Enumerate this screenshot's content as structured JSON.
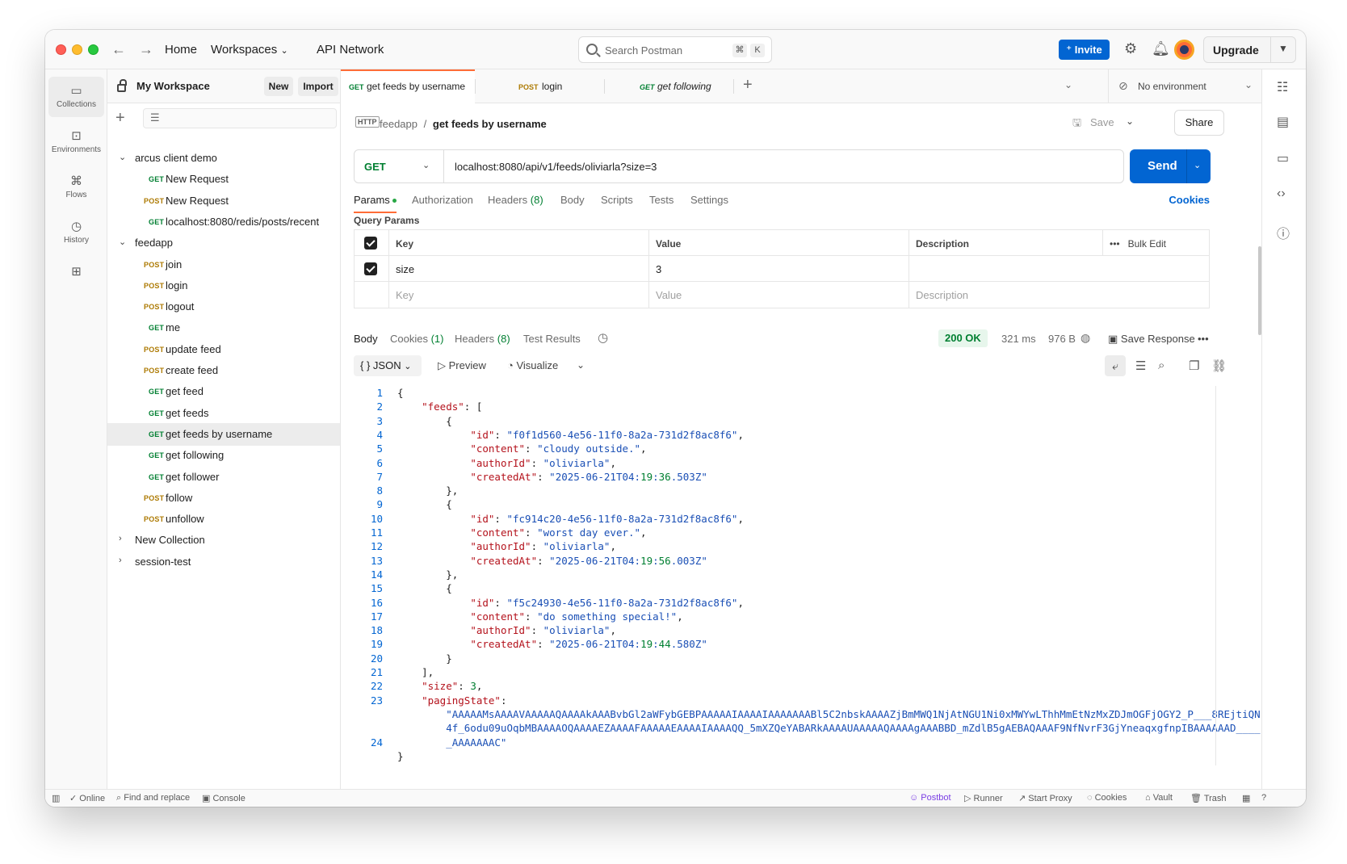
{
  "titlebar": {
    "nav": {
      "home": "Home",
      "workspaces": "Workspaces",
      "api_network": "API Network"
    },
    "search_placeholder": "Search Postman",
    "search_keys": [
      "⌘",
      "K"
    ],
    "invite": "Invite",
    "upgrade": "Upgrade"
  },
  "rail": {
    "items": [
      {
        "label": "Collections",
        "icon": "collections-icon",
        "glyph": "▭"
      },
      {
        "label": "Environments",
        "icon": "environments-icon",
        "glyph": "⊡"
      },
      {
        "label": "Flows",
        "icon": "flows-icon",
        "glyph": "⌘"
      },
      {
        "label": "History",
        "icon": "history-icon",
        "glyph": "◷"
      },
      {
        "label": "",
        "icon": "apps-icon",
        "glyph": "⊞"
      }
    ]
  },
  "sidebar": {
    "workspace_name": "My Workspace",
    "new_button": "New",
    "import_button": "Import",
    "tree": [
      {
        "type": "collection",
        "label": "arcus client demo",
        "expanded": true
      },
      {
        "type": "request",
        "method": "GET",
        "label": "New Request"
      },
      {
        "type": "request",
        "method": "POST",
        "label": "New Request"
      },
      {
        "type": "request",
        "method": "GET",
        "label": "localhost:8080/redis/posts/recent"
      },
      {
        "type": "collection",
        "label": "feedapp",
        "expanded": true
      },
      {
        "type": "request",
        "method": "POST",
        "label": "join"
      },
      {
        "type": "request",
        "method": "POST",
        "label": "login"
      },
      {
        "type": "request",
        "method": "POST",
        "label": "logout"
      },
      {
        "type": "request",
        "method": "GET",
        "label": "me"
      },
      {
        "type": "request",
        "method": "POST",
        "label": "update feed"
      },
      {
        "type": "request",
        "method": "POST",
        "label": "create feed"
      },
      {
        "type": "request",
        "method": "GET",
        "label": "get feed"
      },
      {
        "type": "request",
        "method": "GET",
        "label": "get feeds"
      },
      {
        "type": "request",
        "method": "GET",
        "label": "get feeds by username",
        "selected": true
      },
      {
        "type": "request",
        "method": "GET",
        "label": "get following"
      },
      {
        "type": "request",
        "method": "GET",
        "label": "get follower"
      },
      {
        "type": "request",
        "method": "POST",
        "label": "follow"
      },
      {
        "type": "request",
        "method": "POST",
        "label": "unfollow"
      },
      {
        "type": "collection",
        "label": "New Collection",
        "expanded": false
      },
      {
        "type": "collection",
        "label": "session-test",
        "expanded": false
      }
    ]
  },
  "tabs": [
    {
      "method": "GET",
      "label": "get feeds by username",
      "active": true
    },
    {
      "method": "POST",
      "label": "login",
      "active": false
    },
    {
      "method": "GET",
      "label": "get following",
      "active": false
    }
  ],
  "environment": "No environment",
  "request": {
    "breadcrumb_collection": "feedapp",
    "breadcrumb_sep": "/",
    "breadcrumb_request": "get feeds by username",
    "http_badge": "HTTP",
    "save": "Save",
    "share": "Share",
    "method": "GET",
    "url": "localhost:8080/api/v1/feeds/oliviarla?size=3",
    "send": "Send",
    "subtabs": {
      "params": "Params",
      "authorization": "Authorization",
      "headers": "Headers",
      "headers_count": "(8)",
      "body": "Body",
      "scripts": "Scripts",
      "tests": "Tests",
      "settings": "Settings",
      "cookies": "Cookies"
    },
    "query_params_title": "Query Params",
    "table": {
      "headers": {
        "key": "Key",
        "value": "Value",
        "description": "Description",
        "bulk_edit": "Bulk Edit"
      },
      "rows": [
        {
          "checked": true,
          "key": "size",
          "value": "3",
          "description": ""
        }
      ],
      "placeholders": {
        "key": "Key",
        "value": "Value",
        "description": "Description"
      }
    }
  },
  "response": {
    "tabs": {
      "body": "Body",
      "cookies": "Cookies",
      "cookies_count": "(1)",
      "headers": "Headers",
      "headers_count": "(8)",
      "test_results": "Test Results"
    },
    "status": "200 OK",
    "time": "321 ms",
    "size": "976 B",
    "save_response": "Save Response",
    "format": "JSON",
    "preview": "Preview",
    "visualize": "Visualize",
    "lines": [
      "{",
      "    \"feeds\": [",
      "        {",
      "            \"id\": \"f0f1d560-4e56-11f0-8a2a-731d2f8ac8f6\",",
      "            \"content\": \"cloudy outside.\",",
      "            \"authorId\": \"oliviarla\",",
      "            \"createdAt\": \"2025-06-21T04:19:36.503Z\"",
      "        },",
      "        {",
      "            \"id\": \"fc914c20-4e56-11f0-8a2a-731d2f8ac8f6\",",
      "            \"content\": \"worst day ever.\",",
      "            \"authorId\": \"oliviarla\",",
      "            \"createdAt\": \"2025-06-21T04:19:56.003Z\"",
      "        },",
      "        {",
      "            \"id\": \"f5c24930-4e56-11f0-8a2a-731d2f8ac8f6\",",
      "            \"content\": \"do something special!\",",
      "            \"authorId\": \"oliviarla\",",
      "            \"createdAt\": \"2025-06-21T04:19:44.580Z\"",
      "        }",
      "    ],",
      "    \"size\": 3,",
      "    \"pagingState\":",
      "        \"AAAAAMsAAAAVAAAAAQAAAAkAAABvbGl2aWFybGEBPAAAAAIAAAAIAAAAAAABl5C2nbskAAAAZjBmMWQ1NjAtNGU1Ni0xMWYwLThhMmEtNzMxZDJmOGFjOGY2_P___8REjtiQN",
      "        4f_6odu09uOqbMBAAAAOQAAAAEZAAAAFAAAAAEAAAAIAAAAQQ_5mXZQeYABARkAAAAUAAAAAQAAAAgAAABBD_mZdlB5gAEBAQAAAF9NfNvrF3GjYneaqxgfnpIBAAAAAAD____",
      "        _AAAAAAAC\"",
      "}"
    ],
    "line_numbers": [
      "1",
      "2",
      "3",
      "4",
      "5",
      "6",
      "7",
      "8",
      "9",
      "10",
      "11",
      "12",
      "13",
      "14",
      "15",
      "16",
      "17",
      "18",
      "19",
      "20",
      "21",
      "22",
      "23",
      "",
      "",
      "24"
    ]
  },
  "statusbar": {
    "online": "Online",
    "find_replace": "Find and replace",
    "console": "Console",
    "postbot": "Postbot",
    "runner": "Runner",
    "start_proxy": "Start Proxy",
    "cookies": "Cookies",
    "vault": "Vault",
    "trash": "Trash"
  }
}
